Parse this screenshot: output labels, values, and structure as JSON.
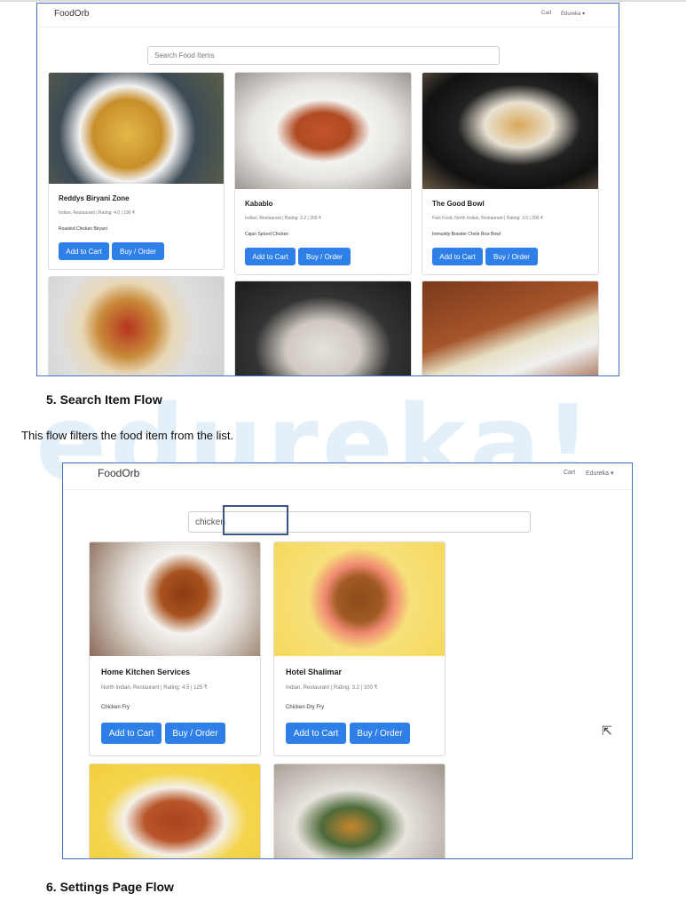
{
  "watermark": "edureka!",
  "shot1": {
    "brand": "FoodOrb",
    "nav_cart": "Cart",
    "nav_user": "Edureka ▾",
    "search_placeholder": "Search Food Items",
    "cards": [
      {
        "title": "Reddys Biryani Zone",
        "meta": "Indian, Restaurant | Rating: 4.0 | 190 ₹",
        "dish": "Roasted Chicken Biryani"
      },
      {
        "title": "Kabablo",
        "meta": "Indian, Restaurant | Rating: 3.2 | 260 ₹",
        "dish": "Cajun Spiced Chicken"
      },
      {
        "title": "The Good Bowl",
        "meta": "Fast Food, North Indian, Restaurant | Rating: 3.0 | 200 ₹",
        "dish": "Immunity Booster Chole Rice Bowl"
      }
    ],
    "add_label": "Add to Cart",
    "buy_label": "Buy / Order"
  },
  "section5": {
    "heading": "5.   Search Item Flow",
    "text": "This flow filters the food item from the list."
  },
  "shot2": {
    "brand": "FoodOrb",
    "nav_cart": "Cart",
    "nav_user": "Edureka ▾",
    "search_value": "chicken",
    "cards": [
      {
        "title": "Home Kitchen Services",
        "meta": "North Indian, Restaurant | Rating: 4.5 | 125 ₹",
        "dish": "Chicken Fry"
      },
      {
        "title": "Hotel Shalimar",
        "meta": "Indian, Restaurant | Rating: 3.2 | 100 ₹",
        "dish": "Chicken Dry Fry"
      }
    ],
    "add_label": "Add to Cart",
    "buy_label": "Buy / Order"
  },
  "section6": {
    "heading": "6.   Settings Page Flow"
  }
}
